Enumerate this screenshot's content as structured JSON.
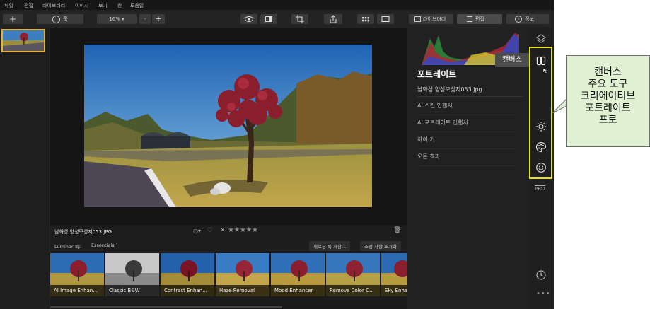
{
  "menu": [
    "파일",
    "편집",
    "라이브러리",
    "이미지",
    "보기",
    "창",
    "도움말"
  ],
  "toolbar": {
    "add_label": "+",
    "looks_label": "룩",
    "zoom_value": "16%",
    "zoom_minus": "-",
    "zoom_plus": "+"
  },
  "right_tabs": {
    "library": "라이브러리",
    "edit": "편집",
    "info": "정보"
  },
  "panel": {
    "title": "포트레이트",
    "filename": "남화성 양성모성지053.jpg",
    "tools": [
      "AI 스킨 인핸서",
      "AI 포트레이트 인핸서",
      "하이 키",
      "오톤 효과"
    ]
  },
  "tooltip": "캔버스",
  "info_bar": {
    "filename": "남화성 양성모성지053.JPG",
    "rating_stars": 0
  },
  "looks_bar": {
    "label": "Luminar 룩:",
    "collection": "Essentials",
    "save_button": "새로운 룩 저장...",
    "reset_button": "조정 사항 초기화"
  },
  "looks": [
    "AI Image Enhan...",
    "Classic B&W",
    "Contrast Enhan...",
    "Haze Removal",
    "Mood Enhancer",
    "Remove Color C...",
    "Sky Enha"
  ],
  "pro_badge": "PRO",
  "callout": {
    "lines": [
      "캔버스",
      "주요 도구",
      "크리에이티브",
      "포트레이트",
      "프로"
    ]
  },
  "colors": {
    "highlight": "#e7e21d",
    "callout_bg": "#dff0d3",
    "selection": "#e2b23a"
  }
}
